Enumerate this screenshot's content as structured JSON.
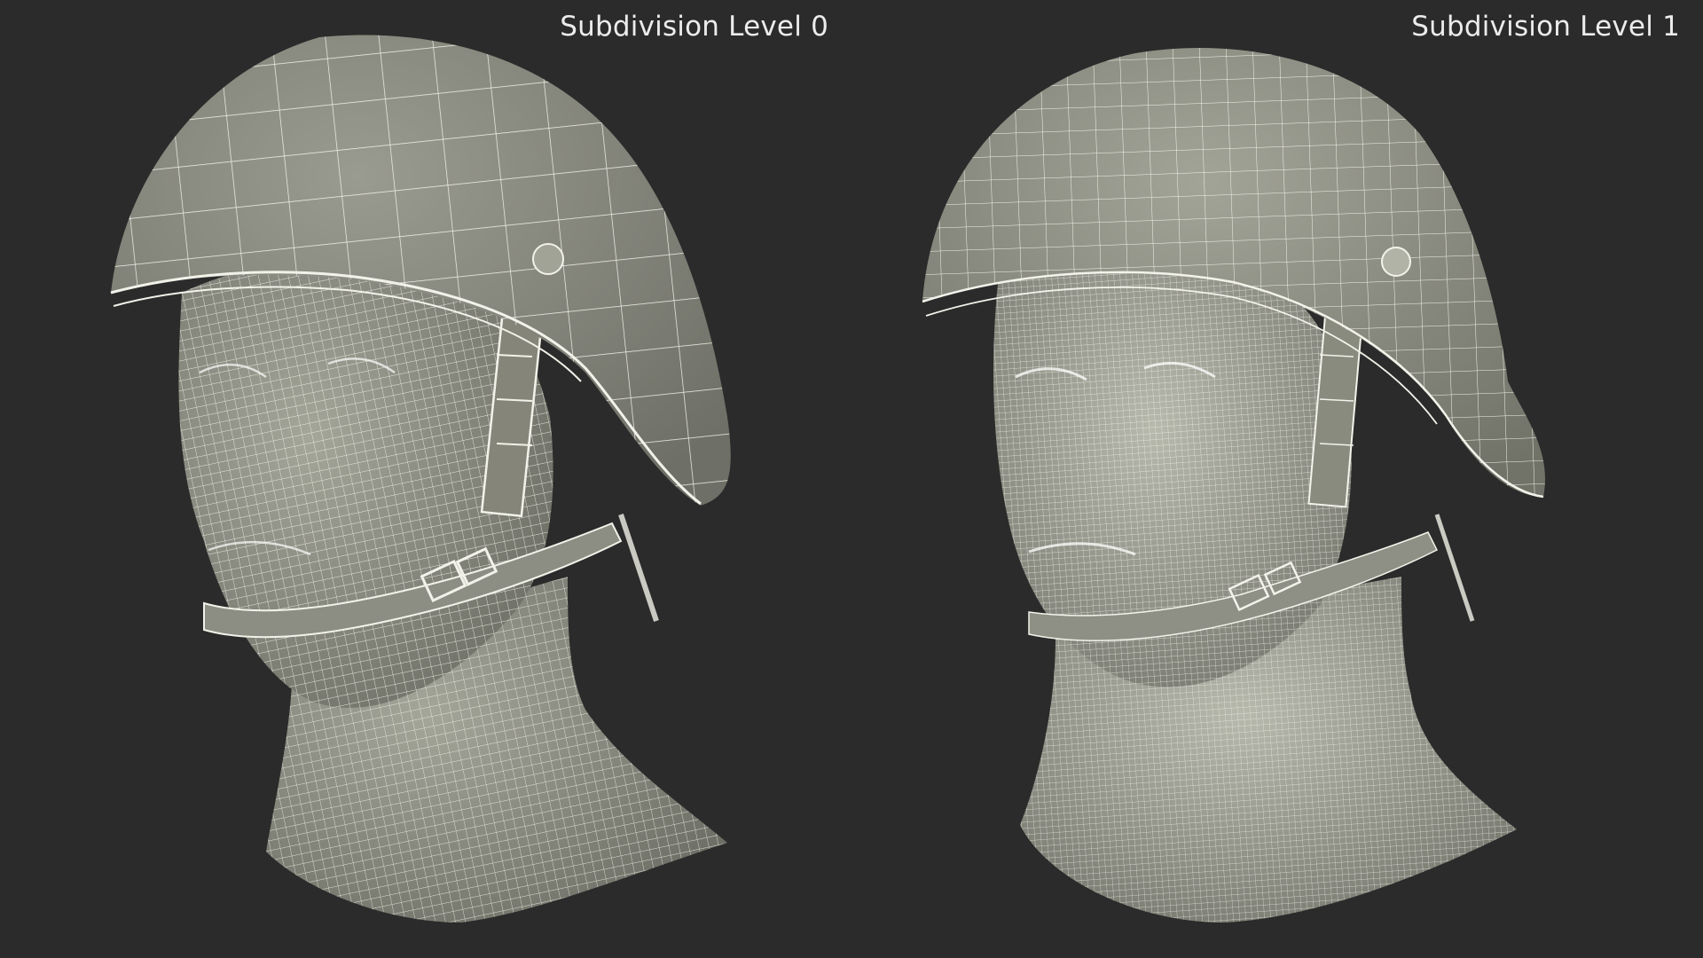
{
  "labels": {
    "left": "Subdivision Level 0",
    "right": "Subdivision Level 1"
  },
  "colors": {
    "background": "#2b2b2b",
    "surface": "#8d8e83",
    "surface_light": "#a7a89c",
    "wire": "#f2f2ea",
    "label": "#ececec"
  },
  "models": [
    {
      "name": "helmet-head-wireframe",
      "subdivision_level": 0
    },
    {
      "name": "helmet-head-wireframe",
      "subdivision_level": 1
    }
  ]
}
